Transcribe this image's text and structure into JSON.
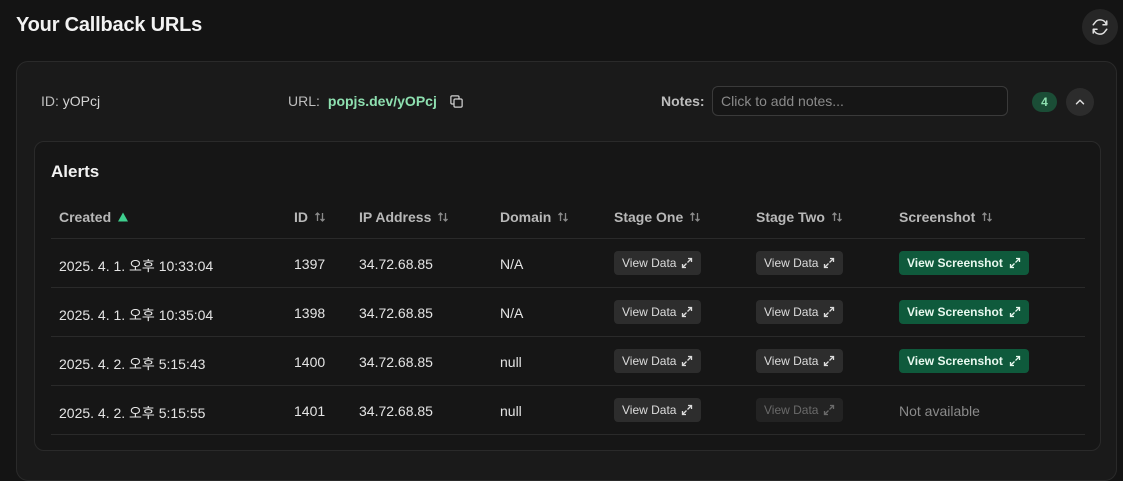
{
  "page": {
    "title": "Your Callback URLs"
  },
  "callback": {
    "id_label": "ID:",
    "id_value": "yOPcj",
    "url_label": "URL:",
    "url_value": "popjs.dev/yOPcj",
    "notes_label": "Notes:",
    "notes_placeholder": "Click to add notes...",
    "alert_count": "4"
  },
  "alerts": {
    "title": "Alerts",
    "columns": [
      "Created",
      "ID",
      "IP Address",
      "Domain",
      "Stage One",
      "Stage Two",
      "Screenshot"
    ],
    "sorted_column": "Created",
    "view_data_label": "View Data",
    "view_screenshot_label": "View Screenshot",
    "not_available_label": "Not available",
    "rows": [
      {
        "created": "2025. 4. 1. 오후 10:33:04",
        "id": "1397",
        "ip": "34.72.68.85",
        "domain": "N/A",
        "stage_two_enabled": true,
        "screenshot": true
      },
      {
        "created": "2025. 4. 1. 오후 10:35:04",
        "id": "1398",
        "ip": "34.72.68.85",
        "domain": "N/A",
        "stage_two_enabled": true,
        "screenshot": true
      },
      {
        "created": "2025. 4. 2. 오후 5:15:43",
        "id": "1400",
        "ip": "34.72.68.85",
        "domain": "null",
        "stage_two_enabled": true,
        "screenshot": true
      },
      {
        "created": "2025. 4. 2. 오후 5:15:55",
        "id": "1401",
        "ip": "34.72.68.85",
        "domain": "null",
        "stage_two_enabled": false,
        "screenshot": false
      }
    ]
  },
  "colors": {
    "accent_green": "#8ee0b0",
    "screenshot_button": "#0f5a3c",
    "sort_arrow": "#3ecf8e"
  }
}
